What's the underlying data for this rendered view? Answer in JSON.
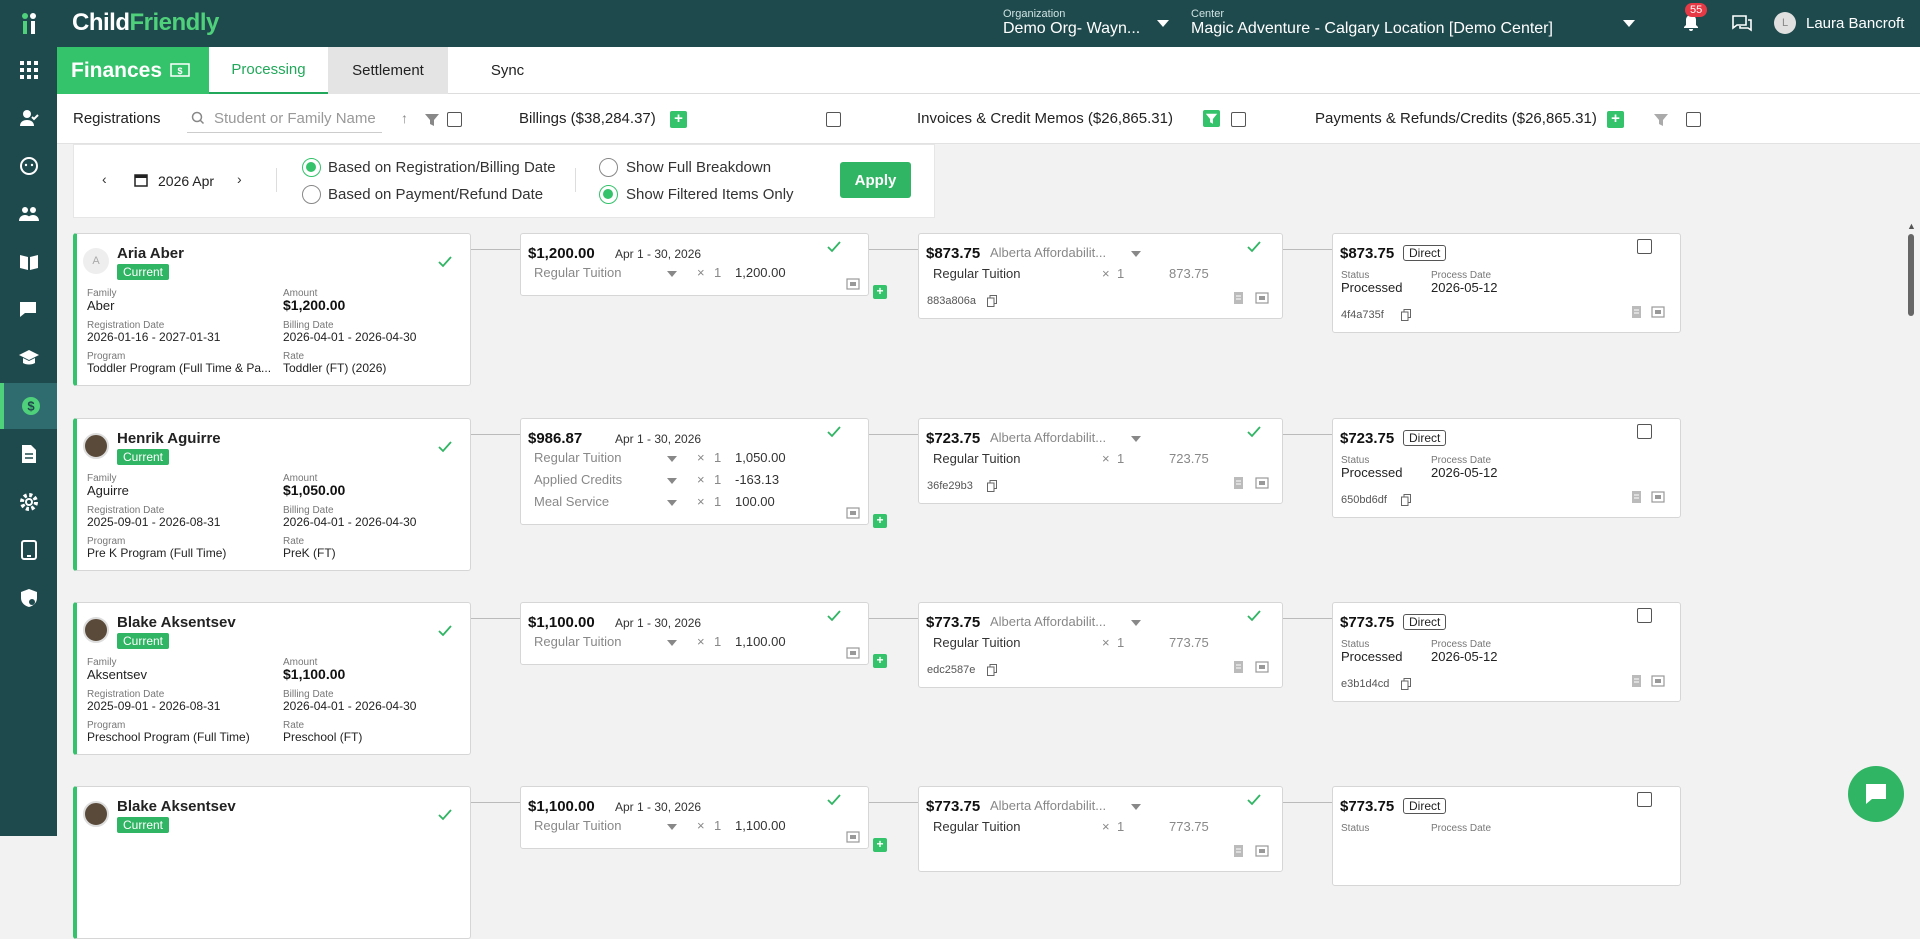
{
  "app": {
    "logo_child": "Child",
    "logo_friendly": "Friendly"
  },
  "top": {
    "org_label": "Organization",
    "org_value": "Demo Org- Wayn...",
    "center_label": "Center",
    "center_value": "Magic Adventure - Calgary Location [Demo Center]",
    "notif_count": "55",
    "user_initial": "L",
    "user_name": "Laura Bancroft"
  },
  "sidebar": {
    "items": [
      "apps-icon",
      "person-check-icon",
      "baby-face-icon",
      "people-icon",
      "book-icon",
      "chat-icon",
      "graduation-cap-icon",
      "finance-dollar-icon",
      "document-icon",
      "settings-icon",
      "tablet-icon",
      "shield-gear-icon"
    ]
  },
  "module": {
    "title": "Finances",
    "tabs": [
      "Processing",
      "Settlement",
      "Sync"
    ]
  },
  "filters": {
    "registrations": "Registrations",
    "search_placeholder": "Student or Family Name",
    "billings": "Billings ($38,284.37)",
    "invoices": "Invoices & Credit Memos ($26,865.31)",
    "payments": "Payments & Refunds/Credits ($26,865.31)"
  },
  "datepanel": {
    "month": "2026 Apr",
    "radio1": "Based on Registration/Billing Date",
    "radio2": "Based on Payment/Refund Date",
    "radio3": "Show Full Breakdown",
    "radio4": "Show Filtered Items Only",
    "apply": "Apply"
  },
  "labels": {
    "family": "Family",
    "amount": "Amount",
    "reg_date": "Registration Date",
    "billing_date": "Billing Date",
    "program": "Program",
    "rate": "Rate",
    "current": "Current",
    "status": "Status",
    "process_date": "Process Date",
    "direct": "Direct",
    "times": "×",
    "one": "1"
  },
  "rows": [
    {
      "name": "Aria Aber",
      "avatar": "A",
      "family": "Aber",
      "amount": "$1,200.00",
      "reg_date": "2026-01-16 - 2027-01-31",
      "billing_date": "2026-04-01 - 2026-04-30",
      "program": "Toddler Program (Full Time & Pa...",
      "rate": "Toddler (FT) (2026)",
      "bill_total": "$1,200.00",
      "bill_period": "Apr 1 - 30, 2026",
      "bill_lines": [
        {
          "label": "Regular Tuition",
          "value": "1,200.00"
        }
      ],
      "inv_total": "$873.75",
      "inv_type": "Alberta Affordabilit...",
      "inv_line": "Regular Tuition",
      "inv_value": "873.75",
      "inv_hash": "883a806a",
      "pay_total": "$873.75",
      "pay_status": "Processed",
      "pay_date": "2026-05-12",
      "pay_hash": "4f4a735f"
    },
    {
      "name": "Henrik Aguirre",
      "avatar": "",
      "family": "Aguirre",
      "amount": "$1,050.00",
      "reg_date": "2025-09-01 - 2026-08-31",
      "billing_date": "2026-04-01 - 2026-04-30",
      "program": "Pre K Program (Full Time)",
      "rate": "PreK (FT)",
      "bill_total": "$986.87",
      "bill_period": "Apr 1 - 30, 2026",
      "bill_lines": [
        {
          "label": "Regular Tuition",
          "value": "1,050.00"
        },
        {
          "label": "Applied Credits",
          "value": "-163.13"
        },
        {
          "label": "Meal Service",
          "value": "100.00"
        }
      ],
      "inv_total": "$723.75",
      "inv_type": "Alberta Affordabilit...",
      "inv_line": "Regular Tuition",
      "inv_value": "723.75",
      "inv_hash": "36fe29b3",
      "pay_total": "$723.75",
      "pay_status": "Processed",
      "pay_date": "2026-05-12",
      "pay_hash": "650bd6df"
    },
    {
      "name": "Blake Aksentsev",
      "avatar": "",
      "family": "Aksentsev",
      "amount": "$1,100.00",
      "reg_date": "2025-09-01 - 2026-08-31",
      "billing_date": "2026-04-01 - 2026-04-30",
      "program": "Preschool Program (Full Time)",
      "rate": "Preschool (FT)",
      "bill_total": "$1,100.00",
      "bill_period": "Apr 1 - 30, 2026",
      "bill_lines": [
        {
          "label": "Regular Tuition",
          "value": "1,100.00"
        }
      ],
      "inv_total": "$773.75",
      "inv_type": "Alberta Affordabilit...",
      "inv_line": "Regular Tuition",
      "inv_value": "773.75",
      "inv_hash": "edc2587e",
      "pay_total": "$773.75",
      "pay_status": "Processed",
      "pay_date": "2026-05-12",
      "pay_hash": "e3b1d4cd"
    },
    {
      "name": "Blake Aksentsev",
      "avatar": "",
      "family": "",
      "amount": "",
      "reg_date": "",
      "billing_date": "",
      "program": "",
      "rate": "",
      "bill_total": "$1,100.00",
      "bill_period": "Apr 1 - 30, 2026",
      "bill_lines": [
        {
          "label": "Regular Tuition",
          "value": "1,100.00"
        }
      ],
      "inv_total": "$773.75",
      "inv_type": "Alberta Affordabilit...",
      "inv_line": "Regular Tuition",
      "inv_value": "773.75",
      "inv_hash": "",
      "pay_total": "$773.75",
      "pay_status": "",
      "pay_date": "",
      "pay_hash": ""
    }
  ],
  "colors": {
    "brand_dark": "#1f4a4d",
    "brand_green": "#34c26b"
  }
}
